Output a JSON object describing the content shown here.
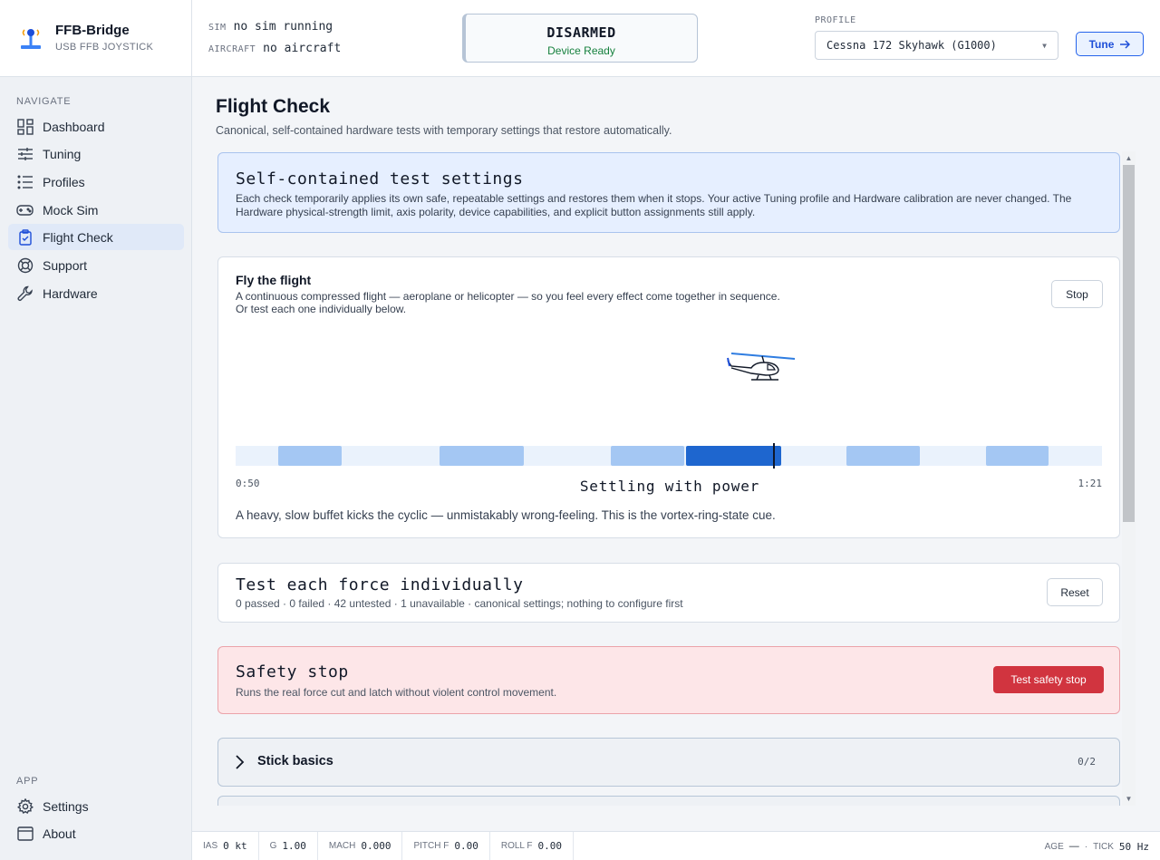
{
  "brand": {
    "name": "FFB-Bridge",
    "subtitle": "USB FFB JOYSTICK",
    "icon": "joystick-icon"
  },
  "nav": {
    "section_navigate": "NAVIGATE",
    "items": [
      {
        "label": "Dashboard",
        "icon": "dashboard-grid-icon"
      },
      {
        "label": "Tuning",
        "icon": "sliders-icon"
      },
      {
        "label": "Profiles",
        "icon": "list-icon"
      },
      {
        "label": "Mock Sim",
        "icon": "gamepad-icon"
      },
      {
        "label": "Flight Check",
        "icon": "clipboard-check-icon",
        "active": true
      },
      {
        "label": "Support",
        "icon": "lifebuoy-icon"
      },
      {
        "label": "Hardware",
        "icon": "wrench-icon"
      }
    ],
    "section_app": "APP",
    "app_items": [
      {
        "label": "Settings",
        "icon": "gear-icon"
      },
      {
        "label": "About",
        "icon": "window-icon"
      }
    ]
  },
  "header": {
    "sim_key": "SIM",
    "sim_value": "no sim running",
    "aircraft_key": "AIRCRAFT",
    "aircraft_value": "no aircraft",
    "status_main": "DISARMED",
    "status_sub": "Device Ready",
    "profile_label": "PROFILE",
    "profile_value": "Cessna 172 Skyhawk (G1000)",
    "tune_label": "Tune"
  },
  "page": {
    "title": "Flight Check",
    "subtitle": "Canonical, self-contained hardware tests with temporary settings that restore automatically."
  },
  "info_card": {
    "title": "Self-contained test settings",
    "description": "Each check temporarily applies its own safe, repeatable settings and restores them when it stops. Your active Tuning profile and Hardware calibration are never changed. The Hardware physical-strength limit, axis polarity, device capabilities, and explicit button assignments still apply."
  },
  "fly_card": {
    "title": "Fly the flight",
    "line1": "A continuous compressed flight — aeroplane or helicopter — so you feel every effect come together in sequence.",
    "line2": "Or test each one individually below.",
    "stop_label": "Stop",
    "vehicle_icon": "helicopter-icon",
    "time_start": "0:50",
    "time_end": "1:21",
    "phase": "Settling with power",
    "phase_description": "A heavy, slow buffet kicks the cyclic — unmistakably wrong-feeling. This is the vortex-ring-state cue."
  },
  "force_card": {
    "title": "Test each force individually",
    "summary": "0 passed · 0 failed · 42 untested · 1 unavailable · canonical settings; nothing to configure first",
    "reset_label": "Reset"
  },
  "safety_card": {
    "title": "Safety stop",
    "description": "Runs the real force cut and latch without violent control movement.",
    "button_label": "Test safety stop"
  },
  "sections": [
    {
      "title": "Stick basics",
      "count": "0/2"
    }
  ],
  "footer": {
    "ias_key": "IAS",
    "ias_value": "0 kt",
    "g_key": "G",
    "g_value": "1.00",
    "mach_key": "MACH",
    "mach_value": "0.000",
    "pitchf_key": "PITCH F",
    "pitchf_value": "0.00",
    "rollf_key": "ROLL F",
    "rollf_value": "0.00",
    "age_key": "AGE",
    "age_value": "—",
    "sep": "·",
    "tick_key": "TICK",
    "tick_value": "50 Hz"
  },
  "colors": {
    "accent": "#1e66cf",
    "danger": "#d1343f",
    "ok": "#15803d"
  }
}
